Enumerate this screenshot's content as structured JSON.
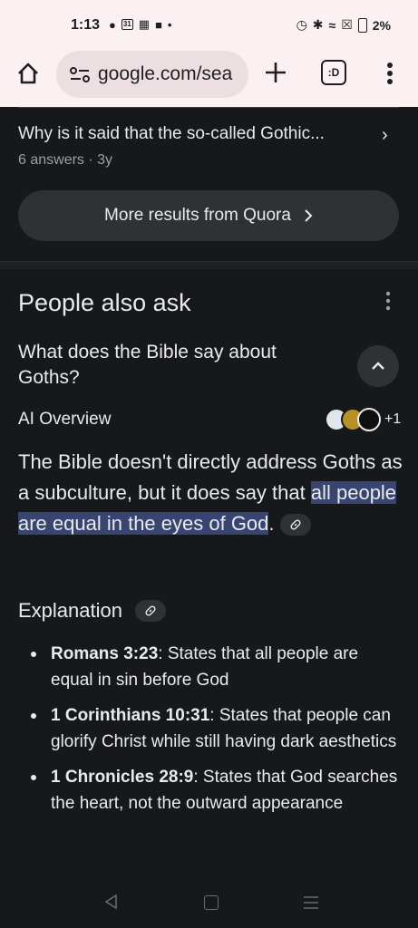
{
  "status_bar": {
    "time": "1:13",
    "left_icons_text": "31",
    "battery": "2%"
  },
  "browser": {
    "url": "google.com/sea",
    "tabs_label": ":D"
  },
  "quora_card": {
    "question": "Why is it said that the so-called Gothic...",
    "meta": "6 answers · 3y",
    "more_button": "More results from Quora"
  },
  "people_also_ask": {
    "title": "People also ask",
    "question": "What does the Bible say about Goths?",
    "ai_overview_label": "AI Overview",
    "sources_more": "+1",
    "answer_prefix": "The Bible doesn't directly address Goths as a subculture, but it does say that ",
    "answer_highlight": "all people are equal in the eyes of God",
    "answer_suffix": ".",
    "explanation_heading": "Explanation",
    "bullets": [
      {
        "ref": "Romans 3:23",
        "text": ": States that all people are equal in sin before God"
      },
      {
        "ref": "1 Corinthians 10:31",
        "text": ": States that people can glorify Christ while still having dark aesthetics"
      },
      {
        "ref": "1 Chronicles 28:9",
        "text": ": States that God searches the heart, not the outward appearance"
      }
    ]
  }
}
